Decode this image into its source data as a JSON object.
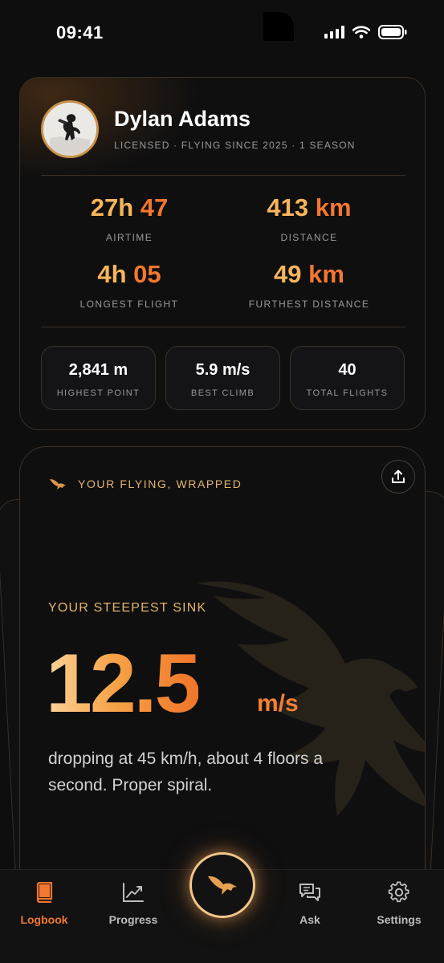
{
  "status_bar": {
    "time": "09:41"
  },
  "profile": {
    "name": "Dylan Adams",
    "subtitle": "LICENSED · FLYING SINCE 2025 · 1 SEASON",
    "stats": [
      {
        "num": "27h",
        "unit": "47",
        "label": "AIRTIME"
      },
      {
        "num": "413",
        "unit": "km",
        "label": "DISTANCE"
      },
      {
        "num": "4h",
        "unit": "05",
        "label": "LONGEST FLIGHT"
      },
      {
        "num": "49",
        "unit": "km",
        "label": "FURTHEST DISTANCE"
      }
    ],
    "mini_stats": [
      {
        "value": "2,841 m",
        "label": "HIGHEST POINT"
      },
      {
        "value": "5.9 m/s",
        "label": "BEST CLIMB"
      },
      {
        "value": "40",
        "label": "TOTAL FLIGHTS"
      }
    ]
  },
  "wrapped": {
    "header": "YOUR FLYING, WRAPPED",
    "title": "YOUR STEEPEST SINK",
    "value": "12.5",
    "unit": "m/s",
    "description": "dropping at 45 km/h, about 4 floors a second. Proper spiral."
  },
  "tabs": [
    {
      "label": "Logbook",
      "icon": "book-icon",
      "active": true
    },
    {
      "label": "Progress",
      "icon": "chart-icon",
      "active": false
    },
    {
      "label": "Ask",
      "icon": "chat-icon",
      "active": false
    },
    {
      "label": "Settings",
      "icon": "gear-icon",
      "active": false
    }
  ],
  "colors": {
    "accent": "#f27730",
    "gold": "#f7b55c",
    "background": "#0e0e0e"
  }
}
